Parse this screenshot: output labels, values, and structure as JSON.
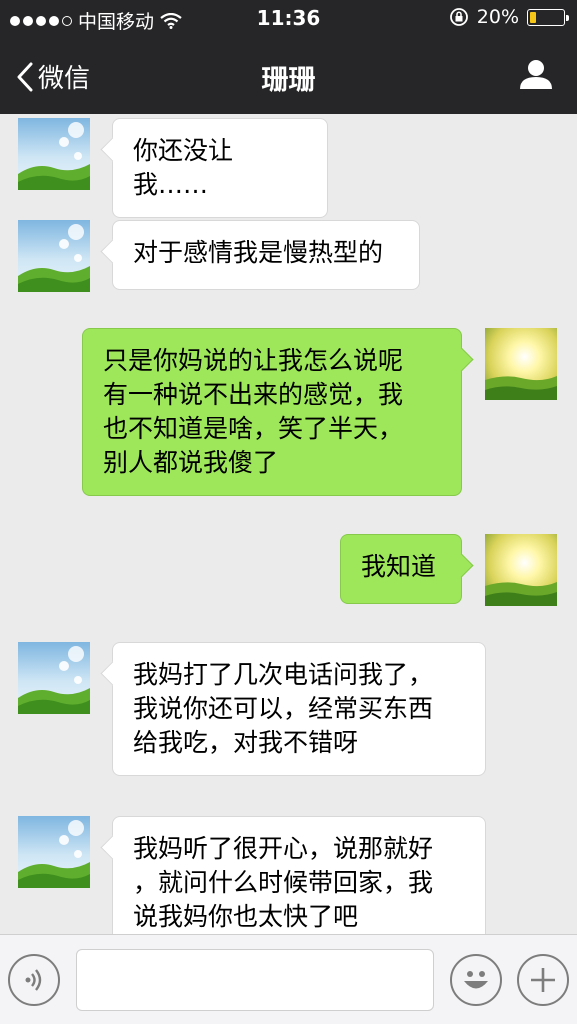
{
  "status_bar": {
    "carrier": "中国移动",
    "time": "11:36",
    "battery": "20%",
    "battery_level": 0.2
  },
  "nav": {
    "back_label": "微信",
    "title": "珊珊"
  },
  "messages": [
    {
      "side": "in",
      "text": "你还没让我……"
    },
    {
      "side": "in",
      "text": "对于感情我是慢热型的"
    },
    {
      "side": "out",
      "text": "只是你妈说的让我怎么说呢\n有一种说不出来的感觉，我\n也不知道是啥，笑了半天，\n别人都说我傻了"
    },
    {
      "side": "out",
      "text": "我知道"
    },
    {
      "side": "in",
      "text": "我妈打了几次电话问我了，\n我说你还可以，经常买东西\n给我吃，对我不错呀"
    },
    {
      "side": "in",
      "text": "我妈听了很开心，说那就好\n，就问什么时候带回家，我\n说我妈你也太快了吧"
    }
  ],
  "input": {
    "value": "",
    "placeholder": ""
  },
  "icons": {
    "voice": "voice-icon",
    "emoji": "emoji-icon",
    "add": "plus-icon",
    "back": "chevron-left-icon",
    "profile": "person-icon",
    "wifi": "wifi-icon",
    "lock": "orientation-lock-icon"
  },
  "colors": {
    "header_bg": "#262628",
    "incoming_bubble": "#ffffff",
    "outgoing_bubble": "#9ee65a",
    "chat_bg": "#ebebeb"
  }
}
